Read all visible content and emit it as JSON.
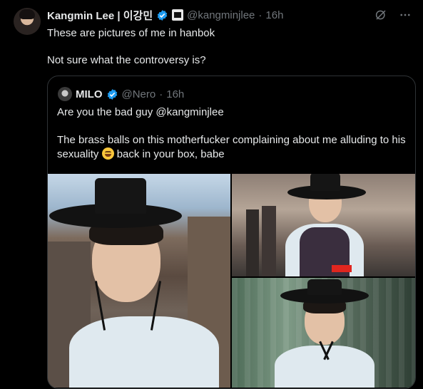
{
  "tweet": {
    "author_name": "Kangmin Lee | 이강민",
    "handle": "@kangminjlee",
    "separator": "·",
    "time": "16h",
    "text_line1": "These are pictures of me in hanbok",
    "text_line2": "Not sure what the controversy is?"
  },
  "quoted": {
    "author_name": "MILO",
    "handle": "@Nero",
    "separator": "·",
    "time": "16h",
    "text_line1": "Are you the bad guy @kangminjlee",
    "text_line2_part1": "The brass balls on this motherfucker complaining about me alluding to his sexuality",
    "text_line2_part2": " back in your box, babe",
    "emoji": "grinning-squinting-face"
  },
  "icons": {
    "verified": "verified-badge-icon",
    "affiliation": "affiliation-badge-icon",
    "grok": "grok-icon",
    "more": "more-icon"
  },
  "colors": {
    "background": "#000000",
    "text": "#e7e9ea",
    "muted": "#71767b",
    "verified_blue": "#1d9bf0",
    "border": "#2f3336"
  }
}
